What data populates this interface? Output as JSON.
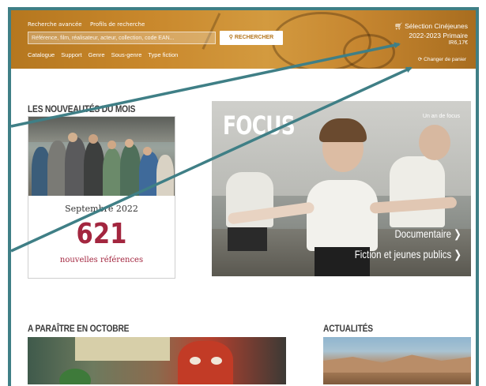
{
  "header": {
    "advanced_search": "Recherche avancée",
    "search_profile": "Profils de recherche",
    "search_placeholder": "Référence, film, réalisateur, acteur, collection, code EAN...",
    "search_button": "RECHERCHER",
    "nav": [
      "Catalogue",
      "Support",
      "Genre",
      "Sous-genre",
      "Type fiction"
    ],
    "selection_line1": "Sélection Cinéjeunes",
    "selection_line2": "2022-2023 Primaire",
    "selection_line3": "IR6,17€",
    "change_basket": "Changer de panier"
  },
  "sections": {
    "new_month": "LES NOUVEAUTÉS DU MOIS",
    "coming_october": "A PARAÎTRE EN OCTOBRE",
    "news": "ACTUALITÉS"
  },
  "new_card": {
    "month": "Septembre 2022",
    "count": "621",
    "subtitle": "nouvelles références"
  },
  "focus": {
    "title": "FOCUS",
    "tag": "Un an de focus",
    "link1": "Documentaire ❯",
    "link2": "Fiction et jeunes publics ❯"
  },
  "icons": {
    "cart": "cart-icon",
    "search": "search-icon",
    "refresh": "refresh-icon"
  },
  "colors": {
    "frame": "#3f7f86",
    "header": "#c9882c",
    "accent": "#a3263f"
  }
}
